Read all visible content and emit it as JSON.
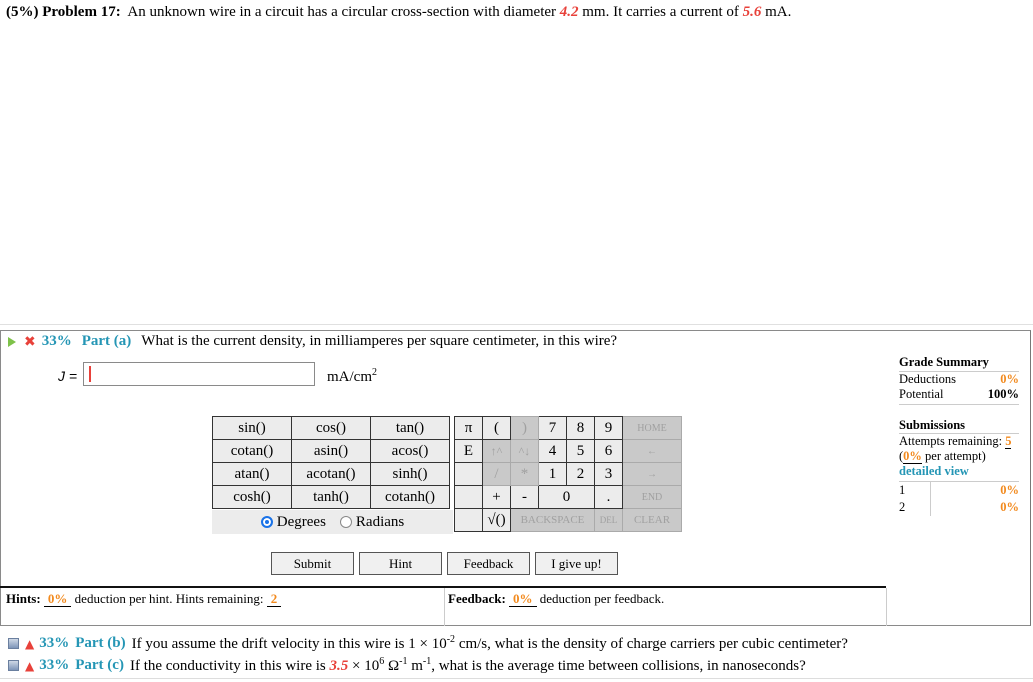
{
  "problem": {
    "weight": "(5%)",
    "number": "Problem 17:",
    "text_1": "An unknown wire in a circuit has a circular cross-section with diameter",
    "diameter": "4.2",
    "text_2": "mm. It carries a current of",
    "current": "5.6",
    "text_3": "mA."
  },
  "part_a": {
    "percent": "33%",
    "label": "Part (a)",
    "question": "What is the current density, in milliamperes per square centimeter, in this wire?",
    "variable": "J =",
    "answer_value": "",
    "units": "mA/cm",
    "units_exp": "2",
    "icons": [
      "play-icon",
      "cross-icon"
    ]
  },
  "calculator": {
    "functions": [
      [
        "sin()",
        "cos()",
        "tan()"
      ],
      [
        "cotan()",
        "asin()",
        "acos()"
      ],
      [
        "atan()",
        "acotan()",
        "sinh()"
      ],
      [
        "cosh()",
        "tanh()",
        "cotanh()"
      ]
    ],
    "angle_modes": [
      "Degrees",
      "Radians"
    ],
    "angle_selected": "Degrees",
    "keys": {
      "pi": "π",
      "lparen": "(",
      "rparen": ")",
      "k7": "7",
      "k8": "8",
      "k9": "9",
      "home": "HOME",
      "e": "E",
      "up": "↑^",
      "down": "^↓",
      "k4": "4",
      "k5": "5",
      "k6": "6",
      "left": "←",
      "div": "/",
      "mul": "*",
      "k1": "1",
      "k2": "2",
      "k3": "3",
      "right": "→",
      "plus": "+",
      "minus": "-",
      "k0": "0",
      "dot": ".",
      "end": "END",
      "sqrt": "√()",
      "backspace": "BACKSPACE",
      "del": "DEL",
      "clear": "CLEAR"
    }
  },
  "actions": {
    "submit": "Submit",
    "hint": "Hint",
    "feedback": "Feedback",
    "give_up": "I give up!"
  },
  "hints": {
    "label": "Hints:",
    "deduction": "0%",
    "text": "deduction per hint. Hints remaining:",
    "remaining": "2"
  },
  "feedback": {
    "label": "Feedback:",
    "deduction": "0%",
    "text": "deduction per feedback."
  },
  "grade_summary": {
    "title": "Grade Summary",
    "deductions_label": "Deductions",
    "deductions_value": "0%",
    "potential_label": "Potential",
    "potential_value": "100%"
  },
  "submissions": {
    "title": "Submissions",
    "attempts_label": "Attempts remaining:",
    "attempts_value": "5",
    "per_attempt_open": "(",
    "per_attempt_value": "0%",
    "per_attempt_text": "per attempt)",
    "detailed_view": "detailed view",
    "rows": [
      {
        "n": "1",
        "v": "0%"
      },
      {
        "n": "2",
        "v": "0%"
      }
    ]
  },
  "part_b": {
    "percent": "33%",
    "label": "Part (b)",
    "text_1": "If you assume the drift velocity in this wire is 1 × 10",
    "exp": "-2",
    "text_2": "cm/s, what is the density of charge carriers per cubic centimeter?"
  },
  "part_c": {
    "percent": "33%",
    "label": "Part (c)",
    "text_1": "If the conductivity in this wire is",
    "value": "3.5",
    "text_2": "× 10",
    "exp1": "6",
    "text_3": "Ω",
    "exp2": "-1",
    "text_4": "m",
    "exp3": "-1",
    "text_5": ", what is the average time between collisions, in nanoseconds?"
  }
}
